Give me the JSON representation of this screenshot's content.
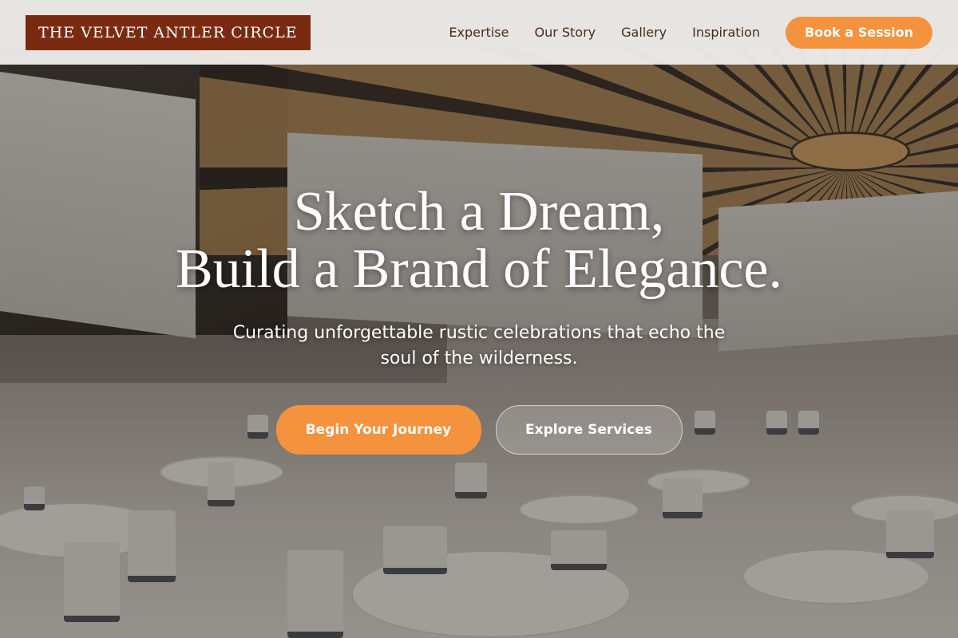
{
  "brand": {
    "name": "THE VELVET ANTLER CIRCLE",
    "color": "#7b2a12"
  },
  "nav": {
    "links": [
      "Expertise",
      "Our Story",
      "Gallery",
      "Inspiration"
    ],
    "cta_label": "Book a Session"
  },
  "hero": {
    "title_line1": "Sketch a Dream,",
    "title_line2": "Build a Brand of Elegance.",
    "subtitle": "Curating unforgettable rustic celebrations that echo the soul of the wilderness.",
    "primary_button": "Begin Your Journey",
    "secondary_button": "Explore Services"
  },
  "colors": {
    "accent": "#f5923e",
    "nav_text": "#4a2a1a"
  }
}
